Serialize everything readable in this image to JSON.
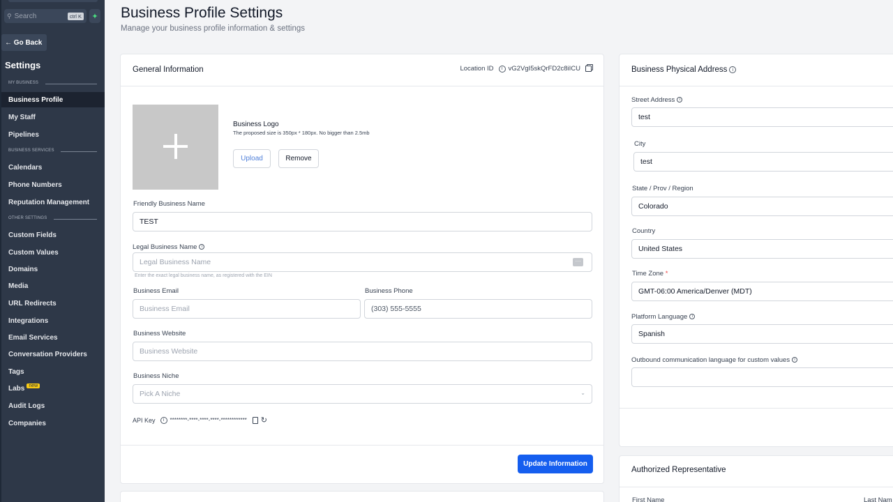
{
  "sidebar": {
    "search_placeholder": "Search",
    "search_shortcut": "ctrl K",
    "go_back": "← Go Back",
    "settings_title": "Settings",
    "sections": {
      "my_business": "MY BUSINESS",
      "business_services": "BUSINESS SERVICES",
      "other_settings": "OTHER SETTINGS"
    },
    "items": [
      {
        "label": "Business Profile"
      },
      {
        "label": "My Staff"
      },
      {
        "label": "Pipelines"
      },
      {
        "label": "Calendars"
      },
      {
        "label": "Phone Numbers"
      },
      {
        "label": "Reputation Management"
      },
      {
        "label": "Custom Fields"
      },
      {
        "label": "Custom Values"
      },
      {
        "label": "Domains"
      },
      {
        "label": "Media"
      },
      {
        "label": "URL Redirects"
      },
      {
        "label": "Integrations"
      },
      {
        "label": "Email Services"
      },
      {
        "label": "Conversation Providers"
      },
      {
        "label": "Tags"
      },
      {
        "label": "Labs",
        "badge": "new"
      },
      {
        "label": "Audit Logs"
      },
      {
        "label": "Companies"
      }
    ]
  },
  "header": {
    "title": "Business Profile Settings",
    "subtitle": "Manage your business profile information & settings"
  },
  "general": {
    "title": "General Information",
    "location_id_label": "Location ID",
    "location_id_value": "vG2VgI5skQrFD2c8iICU",
    "logo_title": "Business Logo",
    "logo_hint": "The proposed size is 350px * 180px. No bigger than 2.5mb",
    "upload": "Upload",
    "remove": "Remove",
    "friendly_name_label": "Friendly Business Name",
    "friendly_name_value": "TEST",
    "legal_name_label": "Legal Business Name",
    "legal_name_placeholder": "Legal Business Name",
    "legal_name_hint": "Enter the exact legal business name, as registered with the EIN",
    "email_label": "Business Email",
    "email_placeholder": "Business Email",
    "phone_label": "Business Phone",
    "phone_placeholder": "(303) 555-5555",
    "website_label": "Business Website",
    "website_placeholder": "Business Website",
    "niche_label": "Business Niche",
    "niche_placeholder": "Pick A Niche",
    "api_key_label": "API Key",
    "api_key_value": "********-****-****-****-************",
    "update_button": "Update Information"
  },
  "address": {
    "title": "Business Physical Address",
    "street_label": "Street Address",
    "street_value": "test",
    "city_label": "City",
    "city_value": "test",
    "state_label": "State / Prov / Region",
    "state_value": "Colorado",
    "country_label": "Country",
    "country_value": "United States",
    "timezone_label": "Time Zone",
    "timezone_required": "*",
    "timezone_value": "GMT-06:00 America/Denver (MDT)",
    "language_label": "Platform Language",
    "language_value": "Spanish",
    "outbound_label": "Outbound communication language for custom values",
    "outbound_value": ""
  },
  "authorized": {
    "title": "Authorized Representative",
    "first_name_label": "First Name",
    "last_name_label": "Last Nam"
  },
  "colors": {
    "sidebar_bg": "#2e3848",
    "active_item_bg": "#1c2330",
    "primary": "#155eef",
    "badge": "#facc15"
  }
}
